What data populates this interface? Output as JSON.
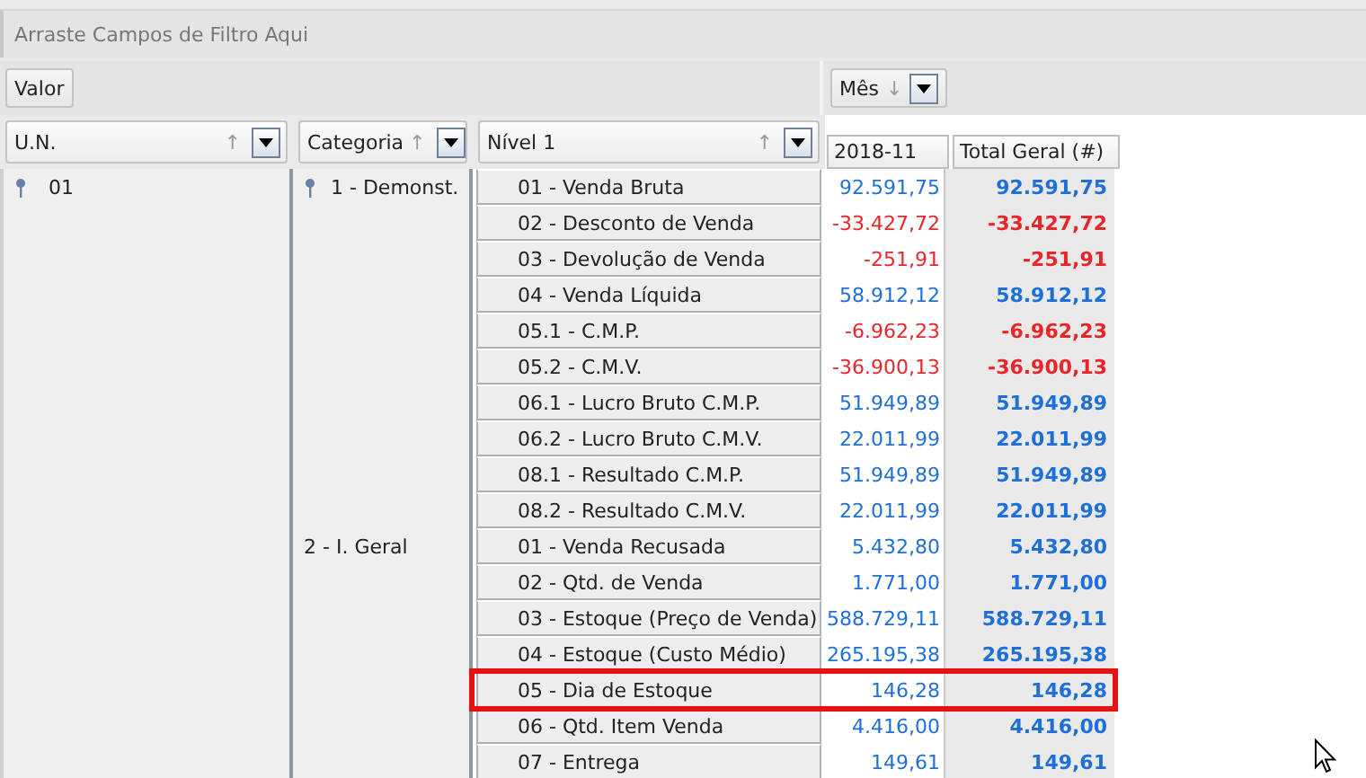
{
  "filter_area": {
    "placeholder": "Arraste Campos de Filtro Aqui"
  },
  "data_fields": [
    "Valor"
  ],
  "column_fields": [
    {
      "label": "Mês",
      "sort": "↓"
    }
  ],
  "row_fields": [
    {
      "label": "U.N.",
      "sort": "↑"
    },
    {
      "label": "Categoria",
      "sort": "↑"
    },
    {
      "label": "Nível 1",
      "sort": "↑"
    }
  ],
  "value_columns": [
    "2018-11",
    "Total Geral (#)"
  ],
  "groups": [
    {
      "label": "01",
      "expanded": true,
      "categories": [
        {
          "label": "1 - Demonst.",
          "expanded": true,
          "rows": [
            {
              "label": "01 - Venda Bruta",
              "value": "92.591,75",
              "total": "92.591,75",
              "negative": false,
              "highlighted": false
            },
            {
              "label": "02 - Desconto de Venda",
              "value": "-33.427,72",
              "total": "-33.427,72",
              "negative": true,
              "highlighted": false
            },
            {
              "label": "03 - Devolução de Venda",
              "value": "-251,91",
              "total": "-251,91",
              "negative": true,
              "highlighted": false
            },
            {
              "label": "04 - Venda Líquida",
              "value": "58.912,12",
              "total": "58.912,12",
              "negative": false,
              "highlighted": false
            },
            {
              "label": "05.1 - C.M.P.",
              "value": "-6.962,23",
              "total": "-6.962,23",
              "negative": true,
              "highlighted": false
            },
            {
              "label": "05.2 - C.M.V.",
              "value": "-36.900,13",
              "total": "-36.900,13",
              "negative": true,
              "highlighted": false
            },
            {
              "label": "06.1 - Lucro Bruto C.M.P.",
              "value": "51.949,89",
              "total": "51.949,89",
              "negative": false,
              "highlighted": false
            },
            {
              "label": "06.2 - Lucro Bruto C.M.V.",
              "value": "22.011,99",
              "total": "22.011,99",
              "negative": false,
              "highlighted": false
            },
            {
              "label": "08.1 - Resultado C.M.P.",
              "value": "51.949,89",
              "total": "51.949,89",
              "negative": false,
              "highlighted": false
            },
            {
              "label": "08.2 - Resultado C.M.V.",
              "value": "22.011,99",
              "total": "22.011,99",
              "negative": false,
              "highlighted": false
            }
          ]
        },
        {
          "label": "2 - I. Geral",
          "expanded": false,
          "rows": [
            {
              "label": "01 - Venda Recusada",
              "value": "5.432,80",
              "total": "5.432,80",
              "negative": false,
              "highlighted": false
            },
            {
              "label": "02 - Qtd. de Venda",
              "value": "1.771,00",
              "total": "1.771,00",
              "negative": false,
              "highlighted": false
            },
            {
              "label": "03 - Estoque (Preço de Venda)",
              "value": "588.729,11",
              "total": "588.729,11",
              "negative": false,
              "highlighted": false
            },
            {
              "label": "04 - Estoque (Custo Médio)",
              "value": "265.195,38",
              "total": "265.195,38",
              "negative": false,
              "highlighted": false
            },
            {
              "label": "05 - Dia de Estoque",
              "value": "146,28",
              "total": "146,28",
              "negative": false,
              "highlighted": true
            },
            {
              "label": "06 - Qtd. Item Venda",
              "value": "4.416,00",
              "total": "4.416,00",
              "negative": false,
              "highlighted": false
            },
            {
              "label": "07 - Entrega",
              "value": "149,61",
              "total": "149,61",
              "negative": false,
              "highlighted": false
            }
          ]
        }
      ]
    }
  ]
}
